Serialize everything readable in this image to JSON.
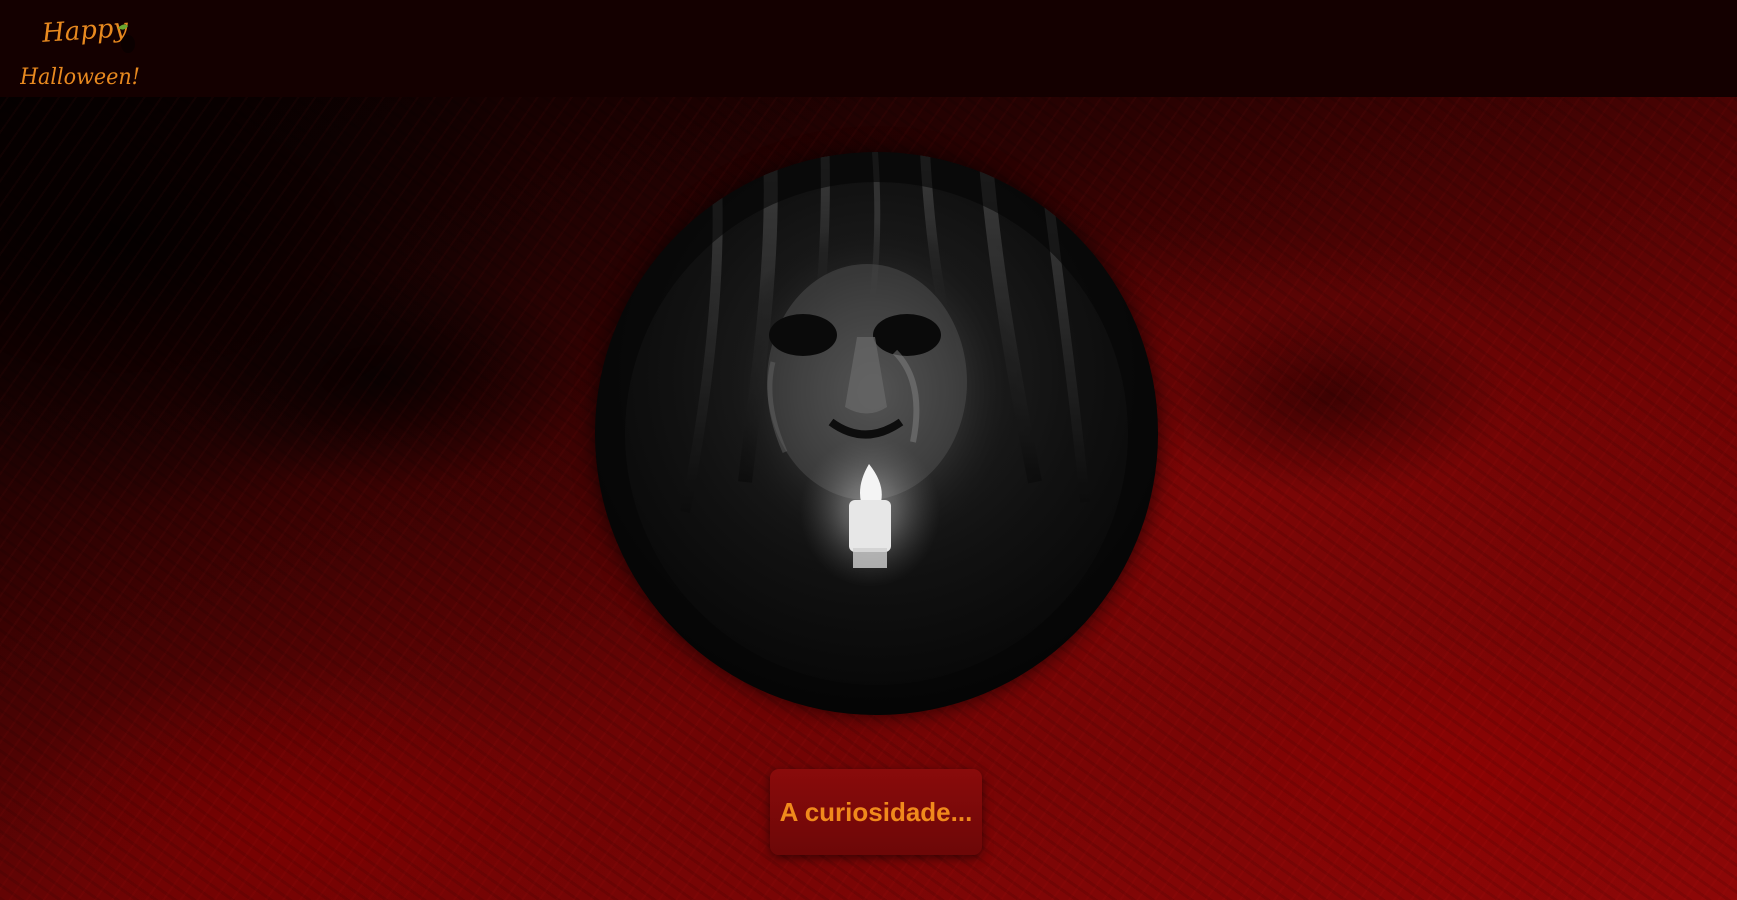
{
  "header": {
    "logo_line1": "Happy",
    "logo_line2": "Halloween!"
  },
  "hero": {
    "image_alt": "ghostly face holding a candle"
  },
  "cta": {
    "label": "A curiosidade..."
  },
  "colors": {
    "header_bg": "#140000",
    "button_bg": "#7d0909",
    "button_text": "#f08a1c",
    "logo_text": "#e8891f"
  }
}
